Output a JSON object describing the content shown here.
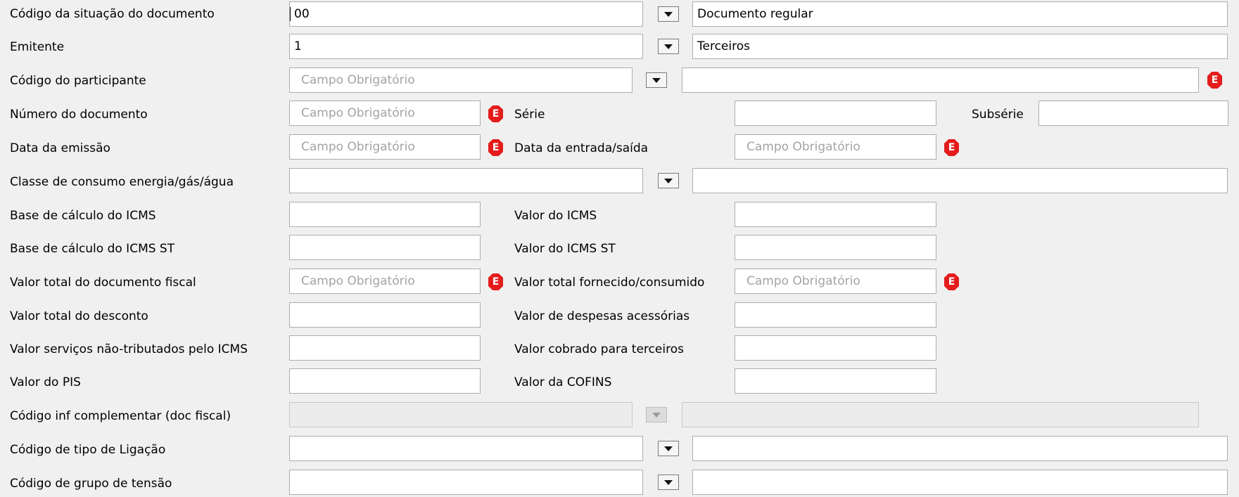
{
  "error_mark": "E",
  "rows": [
    {
      "label": "Código da situação do documento",
      "code": "00",
      "desc": "Documento regular"
    },
    {
      "label": "Emitente",
      "code": "1",
      "desc": "Terceiros"
    },
    {
      "label": "Código do participante",
      "code_placeholder": "Campo Obrigatório"
    },
    {
      "label": "Número do documento",
      "placeholder": "Campo Obrigatório",
      "label2": "Série",
      "label3": "Subsérie"
    },
    {
      "label": "Data da emissão",
      "placeholder": "Campo Obrigatório",
      "label2": "Data da entrada/saída",
      "placeholder2": "Campo Obrigatório"
    },
    {
      "label": "Classe de consumo energia/gás/água"
    },
    {
      "label": "Base de cálculo do ICMS",
      "label2": "Valor do ICMS"
    },
    {
      "label": "Base de cálculo do ICMS ST",
      "label2": "Valor do ICMS ST"
    },
    {
      "label": "Valor total do documento fiscal",
      "placeholder": "Campo Obrigatório",
      "label2": "Valor total fornecido/consumido",
      "placeholder2": "Campo Obrigatório"
    },
    {
      "label": "Valor total do desconto",
      "label2": "Valor de despesas acessórias"
    },
    {
      "label": "Valor serviços não-tributados pelo ICMS",
      "label2": "Valor cobrado para terceiros"
    },
    {
      "label": "Valor do PIS",
      "label2": "Valor da COFINS"
    },
    {
      "label": "Código inf complementar (doc fiscal)"
    },
    {
      "label": "Código de tipo de Ligação"
    },
    {
      "label": "Código de grupo de tensão"
    }
  ]
}
